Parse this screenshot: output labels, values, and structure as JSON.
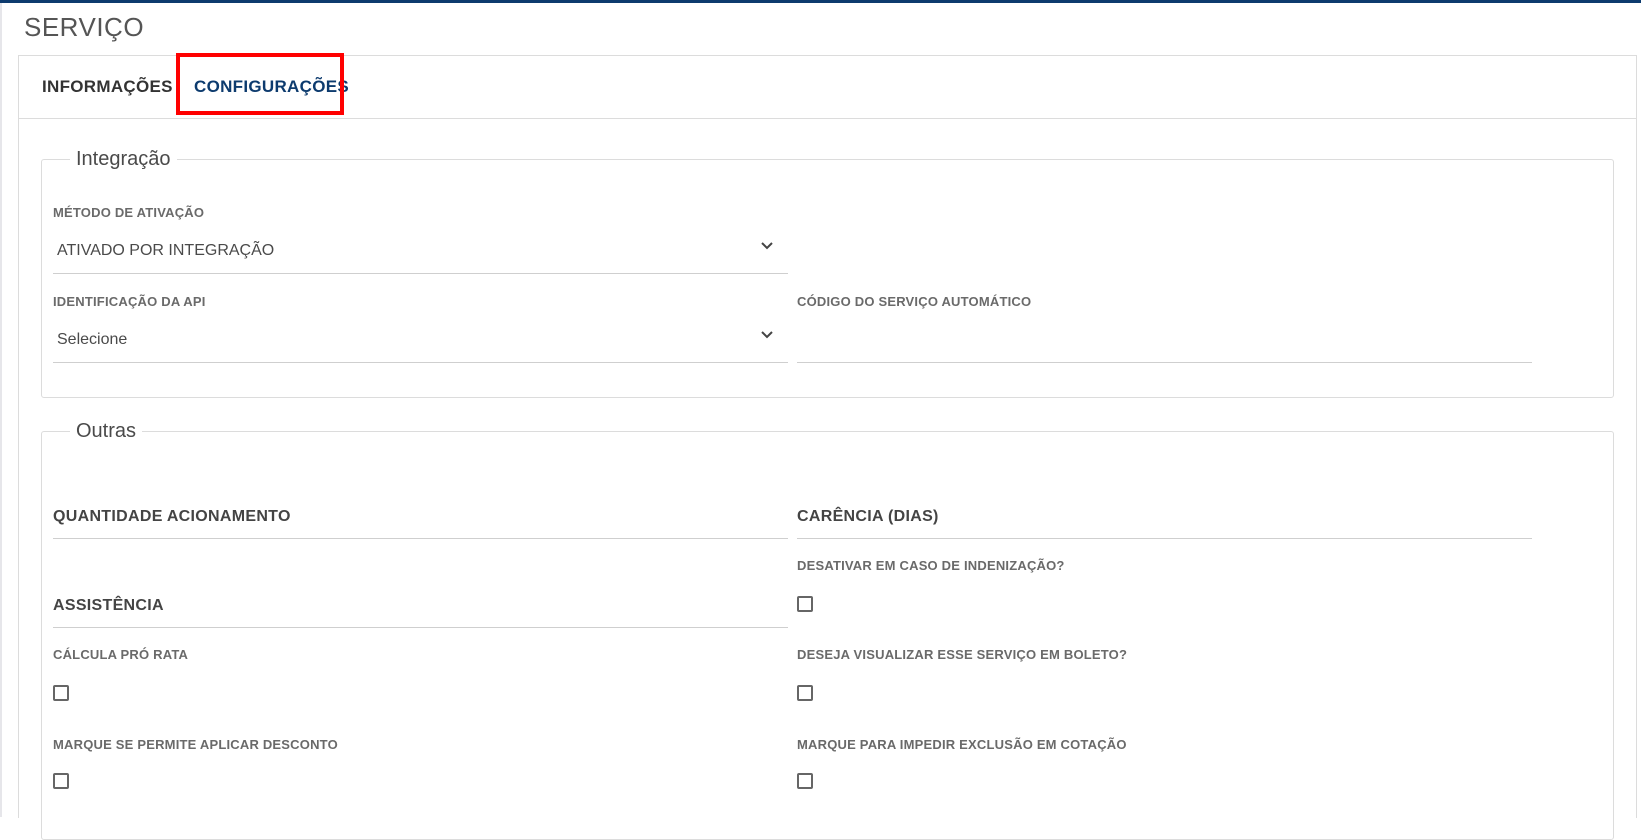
{
  "page": {
    "title": "SERVIÇO"
  },
  "tabs": [
    {
      "label": "INFORMAÇÕES",
      "active": false
    },
    {
      "label": "CONFIGURAÇÕES",
      "active": true
    }
  ],
  "integracao": {
    "legend": "Integração",
    "metodo_ativacao": {
      "label": "MÉTODO DE ATIVAÇÃO",
      "value": "ATIVADO POR INTEGRAÇÃO"
    },
    "identificacao_api": {
      "label": "IDENTIFICAÇÃO DA API",
      "value": "Selecione"
    },
    "codigo_servico": {
      "label": "CÓDIGO DO SERVIÇO AUTOMÁTICO",
      "value": ""
    }
  },
  "outras": {
    "legend": "Outras",
    "quantidade_acionamento": {
      "label": "QUANTIDADE ACIONAMENTO"
    },
    "carencia": {
      "label": "CARÊNCIA (DIAS)"
    },
    "assistencia": {
      "label": "ASSISTÊNCIA"
    },
    "desativar_indenizacao": {
      "label": "DESATIVAR EM CASO DE INDENIZAÇÃO?",
      "checked": false
    },
    "calcula_pro_rata": {
      "label": "CÁLCULA PRÓ RATA",
      "checked": false
    },
    "visualizar_boleto": {
      "label": "DESEJA VISUALIZAR ESSE SERVIÇO EM BOLETO?",
      "checked": false
    },
    "permite_desconto": {
      "label": "MARQUE SE PERMITE APLICAR DESCONTO",
      "checked": false
    },
    "impedir_exclusao": {
      "label": "MARQUE PARA IMPEDIR EXCLUSÃO EM COTAÇÃO",
      "checked": false
    }
  },
  "colors": {
    "brand": "#0d3b6e",
    "highlight": "#ff0000"
  }
}
